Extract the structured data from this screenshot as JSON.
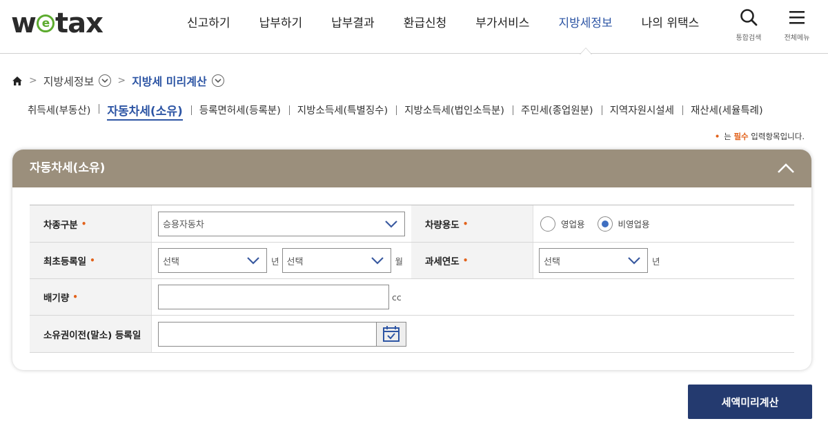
{
  "logo": {
    "pre": "w",
    "mid": "e",
    "post": "tax"
  },
  "gnb": [
    "신고하기",
    "납부하기",
    "납부결과",
    "환급신청",
    "부가서비스",
    "지방세정보",
    "나의 위택스"
  ],
  "gnb_active_index": 5,
  "util": {
    "search_label": "통합검색",
    "menu_label": "전체메뉴"
  },
  "breadcrumb": {
    "level1": "지방세정보",
    "level2": "지방세 미리계산"
  },
  "subtabs": [
    "취득세(부동산)",
    "자동차세(소유)",
    "등록면허세(등록분)",
    "지방소득세(특별징수)",
    "지방소득세(법인소득분)",
    "주민세(종업원분)",
    "지역자원시설세",
    "재산세(세율특례)"
  ],
  "subtab_active_index": 1,
  "required_note": {
    "dot": "•",
    "pre": "는 ",
    "em": "필수",
    "post": " 입력항목입니다."
  },
  "panel": {
    "title": "자동차세(소유)"
  },
  "form": {
    "required_mark": "•",
    "car_type": {
      "label": "차종구분",
      "value": "승용자동차"
    },
    "usage": {
      "label": "차량용도",
      "options": [
        "영업용",
        "비영업용"
      ],
      "selected_index": 1
    },
    "first_reg": {
      "label": "최초등록일",
      "year_value": "선택",
      "year_unit": "년",
      "month_value": "선택",
      "month_unit": "월"
    },
    "tax_year": {
      "label": "과세연도",
      "value": "선택",
      "unit": "년"
    },
    "displacement": {
      "label": "배기량",
      "value": "",
      "unit": "cc"
    },
    "transfer_date": {
      "label": "소유권이전(말소) 등록일",
      "value": ""
    }
  },
  "calc_button": "세액미리계산",
  "colors": {
    "accent": "#2d55a4",
    "panel_head": "#9b8f7c",
    "button": "#243a6f",
    "required": "#e2621b"
  }
}
